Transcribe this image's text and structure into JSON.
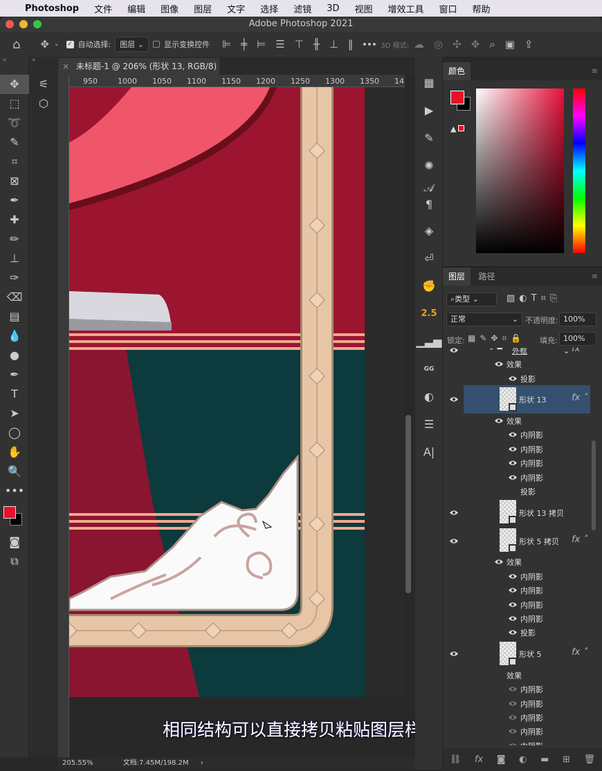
{
  "menubar": {
    "app": "Photoshop",
    "items": [
      "文件",
      "编辑",
      "图像",
      "图层",
      "文字",
      "选择",
      "滤镜",
      "3D",
      "视图",
      "增效工具",
      "窗口",
      "帮助"
    ]
  },
  "window": {
    "title": "Adobe Photoshop 2021"
  },
  "options": {
    "auto_select_label": "自动选择:",
    "auto_select_checked": true,
    "auto_select_value": "图层",
    "show_transform_label": "显示变换控件",
    "show_transform_checked": false,
    "mode_3d_label": "3D 模式:",
    "more": "•••"
  },
  "document": {
    "tab_title": "未标题-1 @ 206% (形状 13, RGB/8) *",
    "close": "×",
    "ruler_ticks": [
      "950",
      "1000",
      "1050",
      "1100",
      "1150",
      "1200",
      "1250",
      "1300",
      "1350",
      "14"
    ]
  },
  "status": {
    "zoom": "205.55%",
    "doc": "文档:7.45M/198.2M",
    "arrow": "›"
  },
  "subtitle": "相同结构可以直接拷贝粘贴图层样式",
  "colors": {
    "foreground": "#e8102a",
    "background": "#000000",
    "canvas_red": "#9b1530",
    "teal": "#0d3a3d",
    "frame": "#e6c6a6",
    "pink": "#f0566a",
    "selection": "#34506e"
  },
  "color_panel": {
    "tab": "颜色"
  },
  "layers_panel": {
    "tabs": [
      "图层",
      "路径"
    ],
    "filter": "类型",
    "blend_mode": "正常",
    "opacity_label": "不透明度:",
    "opacity": "100%",
    "lock_label": "锁定:",
    "fill_label": "填充:",
    "fill": "100%",
    "rows": [
      {
        "kind": "group",
        "label": "外框",
        "eye": true,
        "fx": true
      },
      {
        "kind": "effects",
        "label": "效果",
        "eye": true
      },
      {
        "kind": "effect",
        "label": "投影",
        "eye": true
      },
      {
        "kind": "layer",
        "label": "形状 13",
        "eye": true,
        "fx": true,
        "selected": true
      },
      {
        "kind": "effects",
        "label": "效果",
        "eye": true
      },
      {
        "kind": "effect",
        "label": "内阴影",
        "eye": true
      },
      {
        "kind": "effect",
        "label": "内阴影",
        "eye": true
      },
      {
        "kind": "effect",
        "label": "内阴影",
        "eye": true
      },
      {
        "kind": "effect",
        "label": "内阴影",
        "eye": true
      },
      {
        "kind": "effect",
        "label": "投影",
        "eye": false
      },
      {
        "kind": "layer",
        "label": "形状 13 拷贝",
        "eye": true,
        "fx": false
      },
      {
        "kind": "layer",
        "label": "形状 5 拷贝",
        "eye": true,
        "fx": true
      },
      {
        "kind": "effects",
        "label": "效果",
        "eye": true
      },
      {
        "kind": "effect",
        "label": "内阴影",
        "eye": true
      },
      {
        "kind": "effect",
        "label": "内阴影",
        "eye": true
      },
      {
        "kind": "effect",
        "label": "内阴影",
        "eye": true
      },
      {
        "kind": "effect",
        "label": "内阴影",
        "eye": true
      },
      {
        "kind": "effect",
        "label": "投影",
        "eye": true
      },
      {
        "kind": "layer",
        "label": "形状 5",
        "eye": true,
        "fx": true
      },
      {
        "kind": "effects",
        "label": "效果",
        "eye": false
      },
      {
        "kind": "effect",
        "label": "内阴影",
        "eye": "dim"
      },
      {
        "kind": "effect",
        "label": "内阴影",
        "eye": "dim"
      },
      {
        "kind": "effect",
        "label": "内阴影",
        "eye": "dim"
      },
      {
        "kind": "effect",
        "label": "内阴影",
        "eye": "dim"
      },
      {
        "kind": "effect",
        "label": "内阴影",
        "eye": "dim"
      }
    ],
    "footer_icons": [
      "link-icon",
      "fx-icon",
      "mask-icon",
      "adjustment-icon",
      "folder-icon",
      "new-layer-icon",
      "trash-icon"
    ]
  },
  "right_icons": [
    "grid-icon",
    "play-icon",
    "brush-settings-icon",
    "sparkle-icon",
    "character-icon",
    "paragraph-icon",
    "layers-comp-icon",
    "history-icon",
    "hand-icon",
    "2.5",
    "histogram-icon",
    "gg-icon",
    "adjust-icon",
    "sliders-icon",
    "glyph-icon"
  ],
  "right_icon_2_5": "2.5",
  "right_icon_gg": "GG"
}
